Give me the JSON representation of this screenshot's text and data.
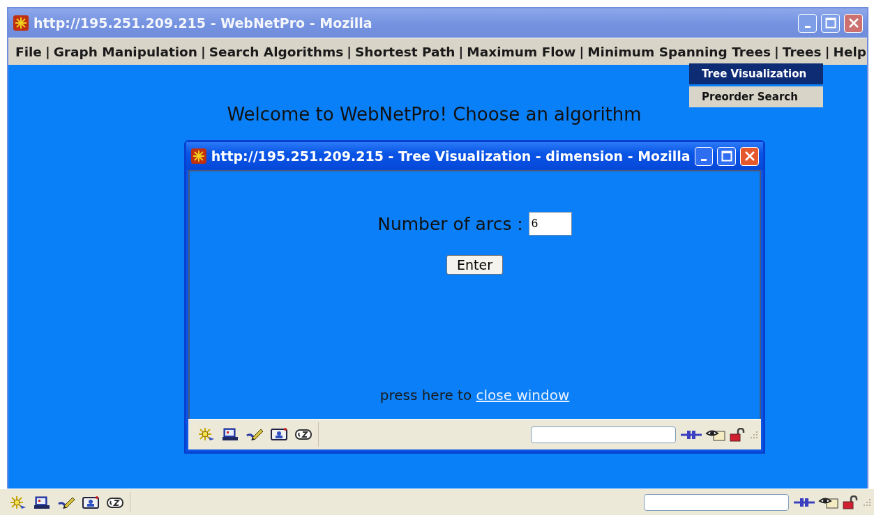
{
  "window": {
    "title": "http://195.251.209.215 - WebNetPro - Mozilla",
    "active": false
  },
  "menu": [
    {
      "label": "File",
      "separator": "|"
    },
    {
      "label": "Graph Manipulation",
      "separator": "|"
    },
    {
      "label": "Search Algorithms",
      "separator": "|"
    },
    {
      "label": "Shortest Path",
      "separator": "|"
    },
    {
      "label": "Maximum Flow",
      "separator": "|"
    },
    {
      "label": "Minimum Spanning Trees",
      "separator": "|"
    },
    {
      "label": "Trees",
      "separator": "|"
    },
    {
      "label": "Help"
    }
  ],
  "dropdown": [
    {
      "label": "Tree Visualization",
      "selected": true
    },
    {
      "label": "Preorder Search",
      "selected": false
    }
  ],
  "heading": "Welcome to WebNetPro! Choose an algorithm",
  "dialog": {
    "title": "http://195.251.209.215 - Tree Visualization - dimension - Mozilla",
    "active": true,
    "field_label": "Number of arcs :",
    "field_value": "6",
    "button": "Enter",
    "close_prompt": "press here to",
    "close_link": "close window"
  }
}
